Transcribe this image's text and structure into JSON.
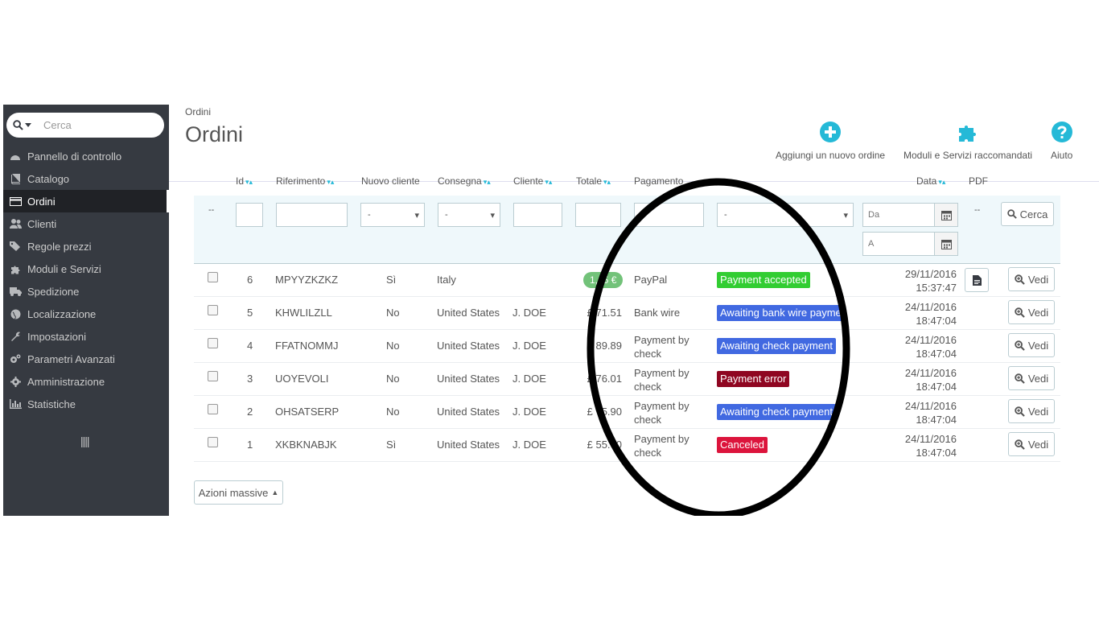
{
  "search": {
    "placeholder": "Cerca"
  },
  "sidebar": {
    "items": [
      {
        "label": "Pannello di controllo",
        "icon": "dashboard-icon"
      },
      {
        "label": "Catalogo",
        "icon": "book-icon"
      },
      {
        "label": "Ordini",
        "icon": "credit-card-icon",
        "active": true
      },
      {
        "label": "Clienti",
        "icon": "users-icon"
      },
      {
        "label": "Regole prezzi",
        "icon": "tags-icon"
      },
      {
        "label": "Moduli e Servizi",
        "icon": "puzzle-icon"
      },
      {
        "label": "Spedizione",
        "icon": "truck-icon"
      },
      {
        "label": "Localizzazione",
        "icon": "globe-icon"
      },
      {
        "label": "Impostazioni",
        "icon": "wrench-icon"
      },
      {
        "label": "Parametri Avanzati",
        "icon": "cogs-icon"
      },
      {
        "label": "Amministrazione",
        "icon": "gear-icon"
      },
      {
        "label": "Statistiche",
        "icon": "bar-chart-icon"
      }
    ]
  },
  "header": {
    "breadcrumb": "Ordini",
    "title": "Ordini",
    "toolbar": {
      "add_order": "Aggiungi un nuovo ordine",
      "modules": "Moduli e Servizi raccomandati",
      "help": "Aiuto"
    }
  },
  "table": {
    "columns": {
      "id": "Id",
      "reference": "Riferimento",
      "new_client": "Nuovo cliente",
      "delivery": "Consegna",
      "customer": "Cliente",
      "total": "Totale",
      "payment": "Pagamento",
      "date": "Data",
      "pdf": "PDF"
    },
    "filters": {
      "placeholder_dash": "--",
      "select_default": "-",
      "date_from": "Da",
      "date_to": "A",
      "search_button": "Cerca"
    },
    "rows": [
      {
        "id": "6",
        "reference": "MPYYZKZKZ",
        "new_client": "Sì",
        "delivery": "Italy",
        "customer": "",
        "total": "1,45 €",
        "payment": "PayPal",
        "status": "Payment accepted",
        "status_color": "#32cd32",
        "date": "29/11/2016",
        "time": "15:37:47",
        "has_pdf": true,
        "view": "Vedi"
      },
      {
        "id": "5",
        "reference": "KHWLILZLL",
        "new_client": "No",
        "delivery": "United States",
        "customer": "J. DOE",
        "total": "£ 71.51",
        "payment": "Bank wire",
        "status": "Awaiting bank wire payment",
        "status_color": "#4169e1",
        "date": "24/11/2016",
        "time": "18:47:04",
        "has_pdf": false,
        "view": "Vedi"
      },
      {
        "id": "4",
        "reference": "FFATNOMMJ",
        "new_client": "No",
        "delivery": "United States",
        "customer": "J. DOE",
        "total": "£ 89.89",
        "payment": "Payment by check",
        "status": "Awaiting check payment",
        "status_color": "#4169e1",
        "date": "24/11/2016",
        "time": "18:47:04",
        "has_pdf": false,
        "view": "Vedi"
      },
      {
        "id": "3",
        "reference": "UOYEVOLI",
        "new_client": "No",
        "delivery": "United States",
        "customer": "J. DOE",
        "total": "£ 76.01",
        "payment": "Payment by check",
        "status": "Payment error",
        "status_color": "#8f0621",
        "date": "24/11/2016",
        "time": "18:47:04",
        "has_pdf": false,
        "view": "Vedi"
      },
      {
        "id": "2",
        "reference": "OHSATSERP",
        "new_client": "No",
        "delivery": "United States",
        "customer": "J. DOE",
        "total": "£ 75.90",
        "payment": "Payment by check",
        "status": "Awaiting check payment",
        "status_color": "#4169e1",
        "date": "24/11/2016",
        "time": "18:47:04",
        "has_pdf": false,
        "view": "Vedi"
      },
      {
        "id": "1",
        "reference": "XKBKNABJK",
        "new_client": "Sì",
        "delivery": "United States",
        "customer": "J. DOE",
        "total": "£ 55.00",
        "payment": "Payment by check",
        "status": "Canceled",
        "status_color": "#dc143c",
        "date": "24/11/2016",
        "time": "18:47:04",
        "has_pdf": false,
        "view": "Vedi"
      }
    ]
  },
  "bulk_actions": "Azioni massive",
  "colors": {
    "sidebar_bg": "#363a41",
    "accent": "#25b9d7",
    "filter_bg": "#eff8fb"
  }
}
